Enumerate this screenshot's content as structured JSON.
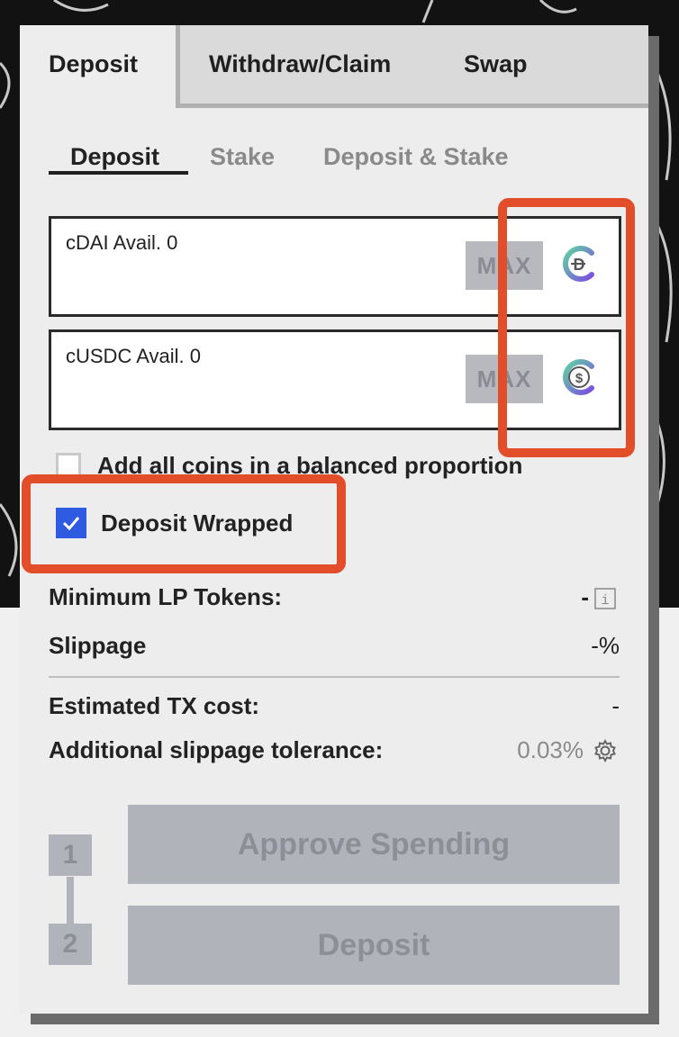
{
  "tabs": [
    "Deposit",
    "Withdraw/Claim",
    "Swap"
  ],
  "subtabs": [
    "Deposit",
    "Stake",
    "Deposit & Stake"
  ],
  "coins": [
    {
      "label": "cDAI Avail. 0",
      "max_label": "MAX",
      "icon": "cdai-coin-icon"
    },
    {
      "label": "cUSDC Avail. 0",
      "max_label": "MAX",
      "icon": "cusdc-coin-icon"
    }
  ],
  "options": {
    "balanced": {
      "label": "Add all coins in a balanced proportion",
      "checked": false
    },
    "wrapped": {
      "label": "Deposit Wrapped",
      "checked": true
    }
  },
  "info": {
    "min_lp_label": "Minimum LP Tokens:",
    "min_lp_value": "-",
    "slippage_label": "Slippage",
    "slippage_value": "-%",
    "tx_cost_label": "Estimated TX cost:",
    "tx_cost_value": "-",
    "tolerance_label": "Additional slippage tolerance:",
    "tolerance_value": "0.03%"
  },
  "steps": [
    {
      "number": "1",
      "label": "Approve Spending"
    },
    {
      "number": "2",
      "label": "Deposit"
    }
  ],
  "colors": {
    "accent_blue": "#2f5be3",
    "highlight": "#e24e2a",
    "disabled_button": "#b1b3ba"
  }
}
